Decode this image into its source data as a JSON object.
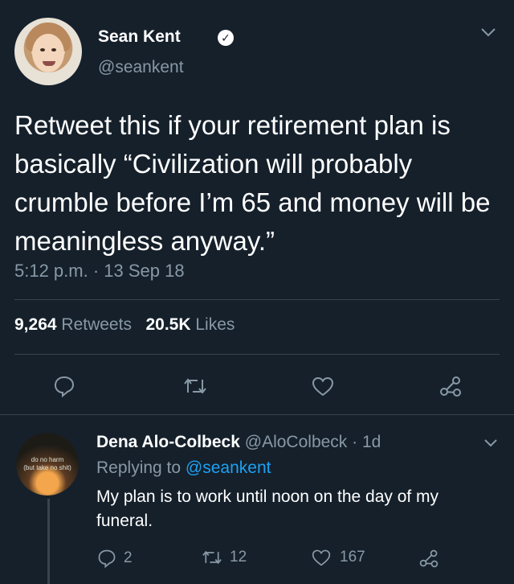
{
  "tweet": {
    "author_name": "Sean Kent",
    "verified_mark": "✓",
    "author_handle": "@seankent",
    "text": "Retweet this if your retirement plan is basically “Civilization will probably crumble before I’m 65 and money will be meaningless anyway.”",
    "timestamp": "5:12 p.m. · 13 Sep 18",
    "retweets_count": "9,264",
    "retweets_label": "Retweets",
    "likes_count": "20.5K",
    "likes_label": "Likes"
  },
  "reply": {
    "author_name": "Dena Alo-Colbeck",
    "author_handle": "@AloColbeck",
    "time_ago": "· 1d",
    "replying_prefix": "Replying to",
    "replying_to": "@seankent",
    "text": "My plan is to work until noon on the day of my funeral.",
    "avatar_text_1": "do no harm",
    "avatar_text_2": "(but take no shit)",
    "reply_count": "2",
    "retweet_count": "12",
    "like_count": "167"
  },
  "colors": {
    "background": "#15202b",
    "muted": "#8899a6",
    "link": "#1da1f2",
    "divider": "#38444d"
  },
  "icons": {
    "reply": "speech-bubble-icon",
    "retweet": "retweet-icon",
    "like": "heart-icon",
    "share": "share-icon",
    "menu": "chevron-down-icon"
  }
}
